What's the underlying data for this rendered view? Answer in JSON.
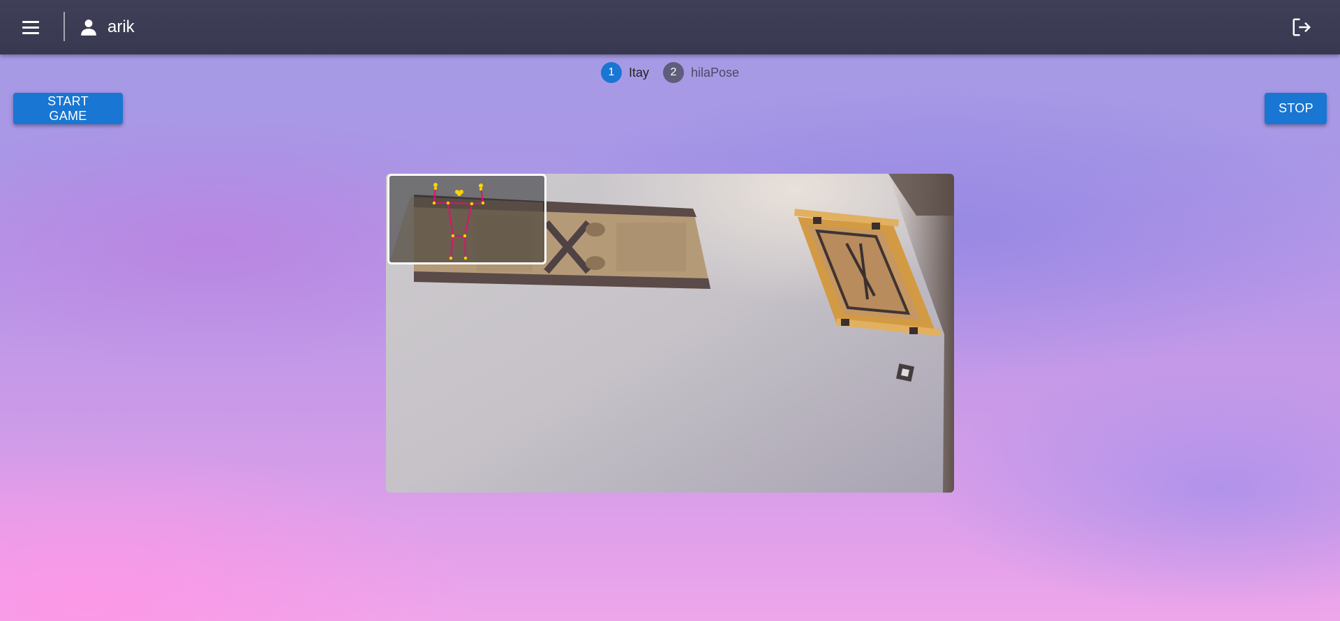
{
  "appbar": {
    "menu_icon": "menu-icon",
    "user_icon": "person-icon",
    "username": "arik",
    "logout_icon": "logout-icon"
  },
  "stepper": {
    "steps": [
      {
        "number": "1",
        "label": "Itay",
        "state": "active"
      },
      {
        "number": "2",
        "label": "hilaPose",
        "state": "inactive"
      }
    ]
  },
  "actions": {
    "start_label": "START GAME",
    "stop_label": "STOP"
  },
  "colors": {
    "appbar": "#3f3f58",
    "primary": "#1976d2",
    "step_inactive": "#5e5e7a",
    "skeleton_bone": "#e0106e",
    "skeleton_joint": "#ffd400"
  }
}
